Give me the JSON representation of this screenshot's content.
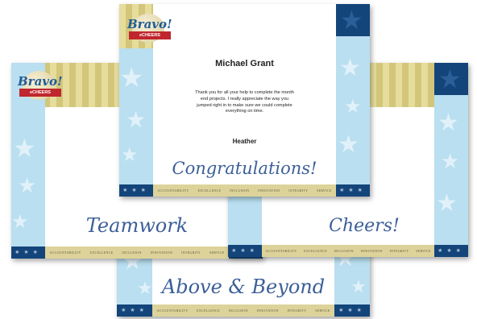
{
  "logo": {
    "title": "Bravo!",
    "subtitle": "eCHEERS"
  },
  "values_strip": [
    "ACCOUNTABILITY",
    "EXCELLENCE",
    "INCLUSION",
    "INNOVATION",
    "INTEGRITY",
    "SERVICE"
  ],
  "cards": {
    "front": {
      "recipient": "Michael Grant",
      "message": "Thank you for all your help to complete the month end projects. I really appreciate the way you jumped right in to make sure we could complete everything on time.",
      "sender": "Heather",
      "headline": "Congratulations!"
    },
    "left": {
      "headline": "Teamwork"
    },
    "right": {
      "headline": "Cheers!"
    },
    "bottom": {
      "headline": "Above & Beyond"
    }
  },
  "colors": {
    "navy": "#14457a",
    "sky": "#b9dff0",
    "gold": "#d3c67a",
    "script": "#3c5f98",
    "ribbon": "#c0262d"
  },
  "icons": [
    "star-icon"
  ]
}
